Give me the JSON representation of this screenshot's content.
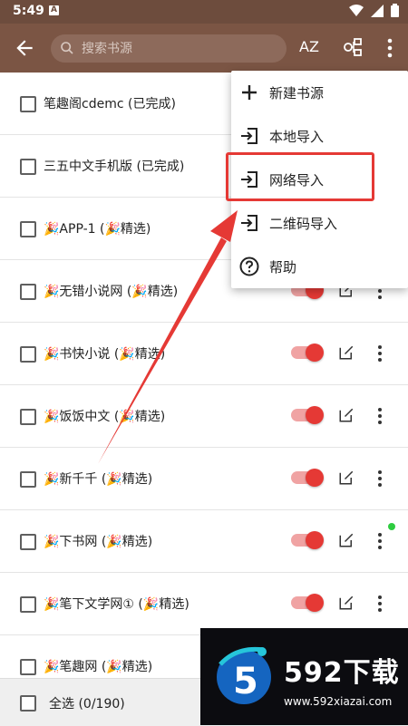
{
  "status": {
    "time": "5:49",
    "notif_icon": "A"
  },
  "toolbar": {
    "search_placeholder": "搜索书源",
    "sort_label": "AZ"
  },
  "sources": [
    {
      "name": "笔趣阁cdemc (已完成)"
    },
    {
      "name": "三五中文手机版 (已完成)"
    },
    {
      "name": "🎉APP-1 (🎉精选)"
    },
    {
      "name": "🎉无错小说网 (🎉精选)"
    },
    {
      "name": "🎉书快小说 (🎉精选)"
    },
    {
      "name": "🎉饭饭中文 (🎉精选)"
    },
    {
      "name": "🎉新千千 (🎉精选)"
    },
    {
      "name": "🎉下书网 (🎉精选)"
    },
    {
      "name": "🎉笔下文学网① (🎉精选)"
    },
    {
      "name": "🎉笔趣网 (🎉精选)"
    }
  ],
  "bottom": {
    "select_all": "全选 (0/190)"
  },
  "menu": {
    "items": [
      {
        "label": "新建书源",
        "icon": "plus-icon"
      },
      {
        "label": "本地导入",
        "icon": "import-icon"
      },
      {
        "label": "网络导入",
        "icon": "import-icon"
      },
      {
        "label": "二维码导入",
        "icon": "import-icon"
      },
      {
        "label": "帮助",
        "icon": "help-icon"
      }
    ]
  },
  "watermark": {
    "title": "592下载",
    "url": "www.592xiazai.com"
  },
  "colors": {
    "toolbar": "#7b5544",
    "statusbar": "#6d4c3d",
    "accent": "#e53935",
    "highlight": "#e53935"
  }
}
